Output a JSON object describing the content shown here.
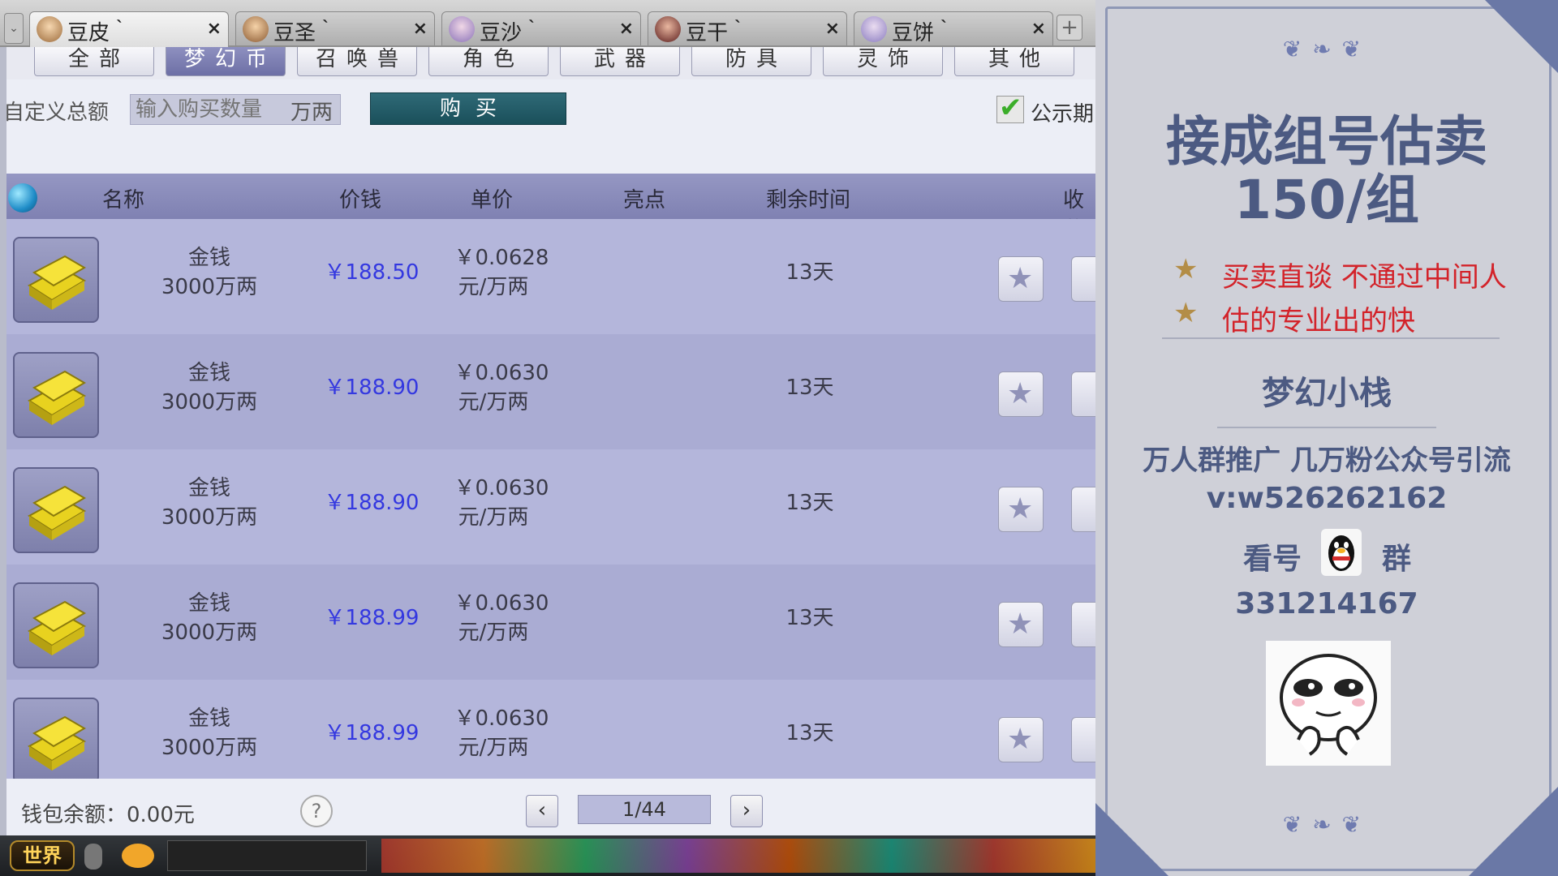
{
  "tabs": [
    {
      "label": "豆皮｀",
      "close": "×"
    },
    {
      "label": "豆圣｀",
      "close": "×"
    },
    {
      "label": "豆沙｀",
      "close": "×"
    },
    {
      "label": "豆干｀",
      "close": "×"
    },
    {
      "label": "豆饼｀",
      "close": "×"
    }
  ],
  "tab_dropdown": "⌄",
  "tab_add": "+",
  "categories": [
    "全部",
    "梦幻币",
    "召唤兽",
    "角色",
    "武器",
    "防具",
    "灵饰",
    "其他"
  ],
  "buy_bar": {
    "custom_label": "自定义总额",
    "qty_placeholder": "输入购买数量",
    "qty_unit": "万两",
    "buy_button": "购买",
    "public_label": "公示期"
  },
  "list_headers": {
    "name": "名称",
    "price": "价钱",
    "unit_price": "单价",
    "highlight": "亮点",
    "remaining_time": "剩余时间",
    "collect": "收藏"
  },
  "items": [
    {
      "name": "金钱",
      "amount": "3000万两",
      "price": "￥188.50",
      "unit_price": "￥0.0628",
      "unit": "元/万两",
      "remaining": "13天"
    },
    {
      "name": "金钱",
      "amount": "3000万两",
      "price": "￥188.90",
      "unit_price": "￥0.0630",
      "unit": "元/万两",
      "remaining": "13天"
    },
    {
      "name": "金钱",
      "amount": "3000万两",
      "price": "￥188.90",
      "unit_price": "￥0.0630",
      "unit": "元/万两",
      "remaining": "13天"
    },
    {
      "name": "金钱",
      "amount": "3000万两",
      "price": "￥188.99",
      "unit_price": "￥0.0630",
      "unit": "元/万两",
      "remaining": "13天"
    },
    {
      "name": "金钱",
      "amount": "3000万两",
      "price": "￥188.99",
      "unit_price": "￥0.0630",
      "unit": "元/万两",
      "remaining": "13天"
    }
  ],
  "footer": {
    "wallet": "钱包余额：0.00元",
    "help": "?",
    "prev": "‹",
    "page": "1/44",
    "next": "›"
  },
  "taskbar": {
    "world": "世界"
  },
  "promo": {
    "title_line1": "接成组号估卖",
    "title_line2": "150/组",
    "bullet_star": "★",
    "bullet1": "买卖直谈 不通过中间人",
    "bullet2": "估的专业出的快",
    "brand": "梦幻小栈",
    "tagline": "万人群推广 几万粉公众号引流",
    "wechat": "v:w526262162",
    "look_left": "看号",
    "look_right": "群",
    "group_number": "331214167",
    "ornament": "❦ ❧ ❦"
  },
  "colors": {
    "price_blue": "#3438e0",
    "promo_title": "#4c5a82",
    "promo_red": "#d3232a",
    "buy_button": "#1f5a66"
  }
}
